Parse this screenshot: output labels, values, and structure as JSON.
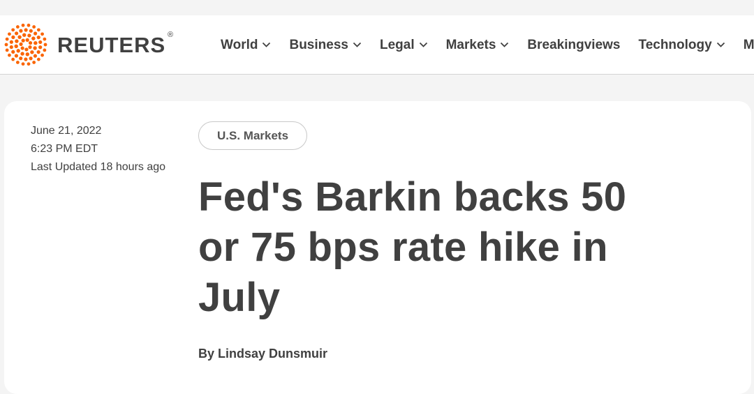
{
  "brand": {
    "name": "REUTERS",
    "registered_mark": "®",
    "accent_color": "#fa6400"
  },
  "nav": {
    "items": [
      {
        "label": "World",
        "has_dropdown": true
      },
      {
        "label": "Business",
        "has_dropdown": true
      },
      {
        "label": "Legal",
        "has_dropdown": true
      },
      {
        "label": "Markets",
        "has_dropdown": true
      },
      {
        "label": "Breakingviews",
        "has_dropdown": false
      },
      {
        "label": "Technology",
        "has_dropdown": true
      },
      {
        "label": "More",
        "has_dropdown": true
      }
    ]
  },
  "article": {
    "date": "June 21, 2022",
    "time": "6:23 PM EDT",
    "updated": "Last Updated 18 hours ago",
    "section_tag": "U.S. Markets",
    "headline": "Fed's Barkin backs 50 or 75 bps rate hike in July",
    "byline_prefix": "By",
    "author": "Lindsay Dunsmuir"
  }
}
